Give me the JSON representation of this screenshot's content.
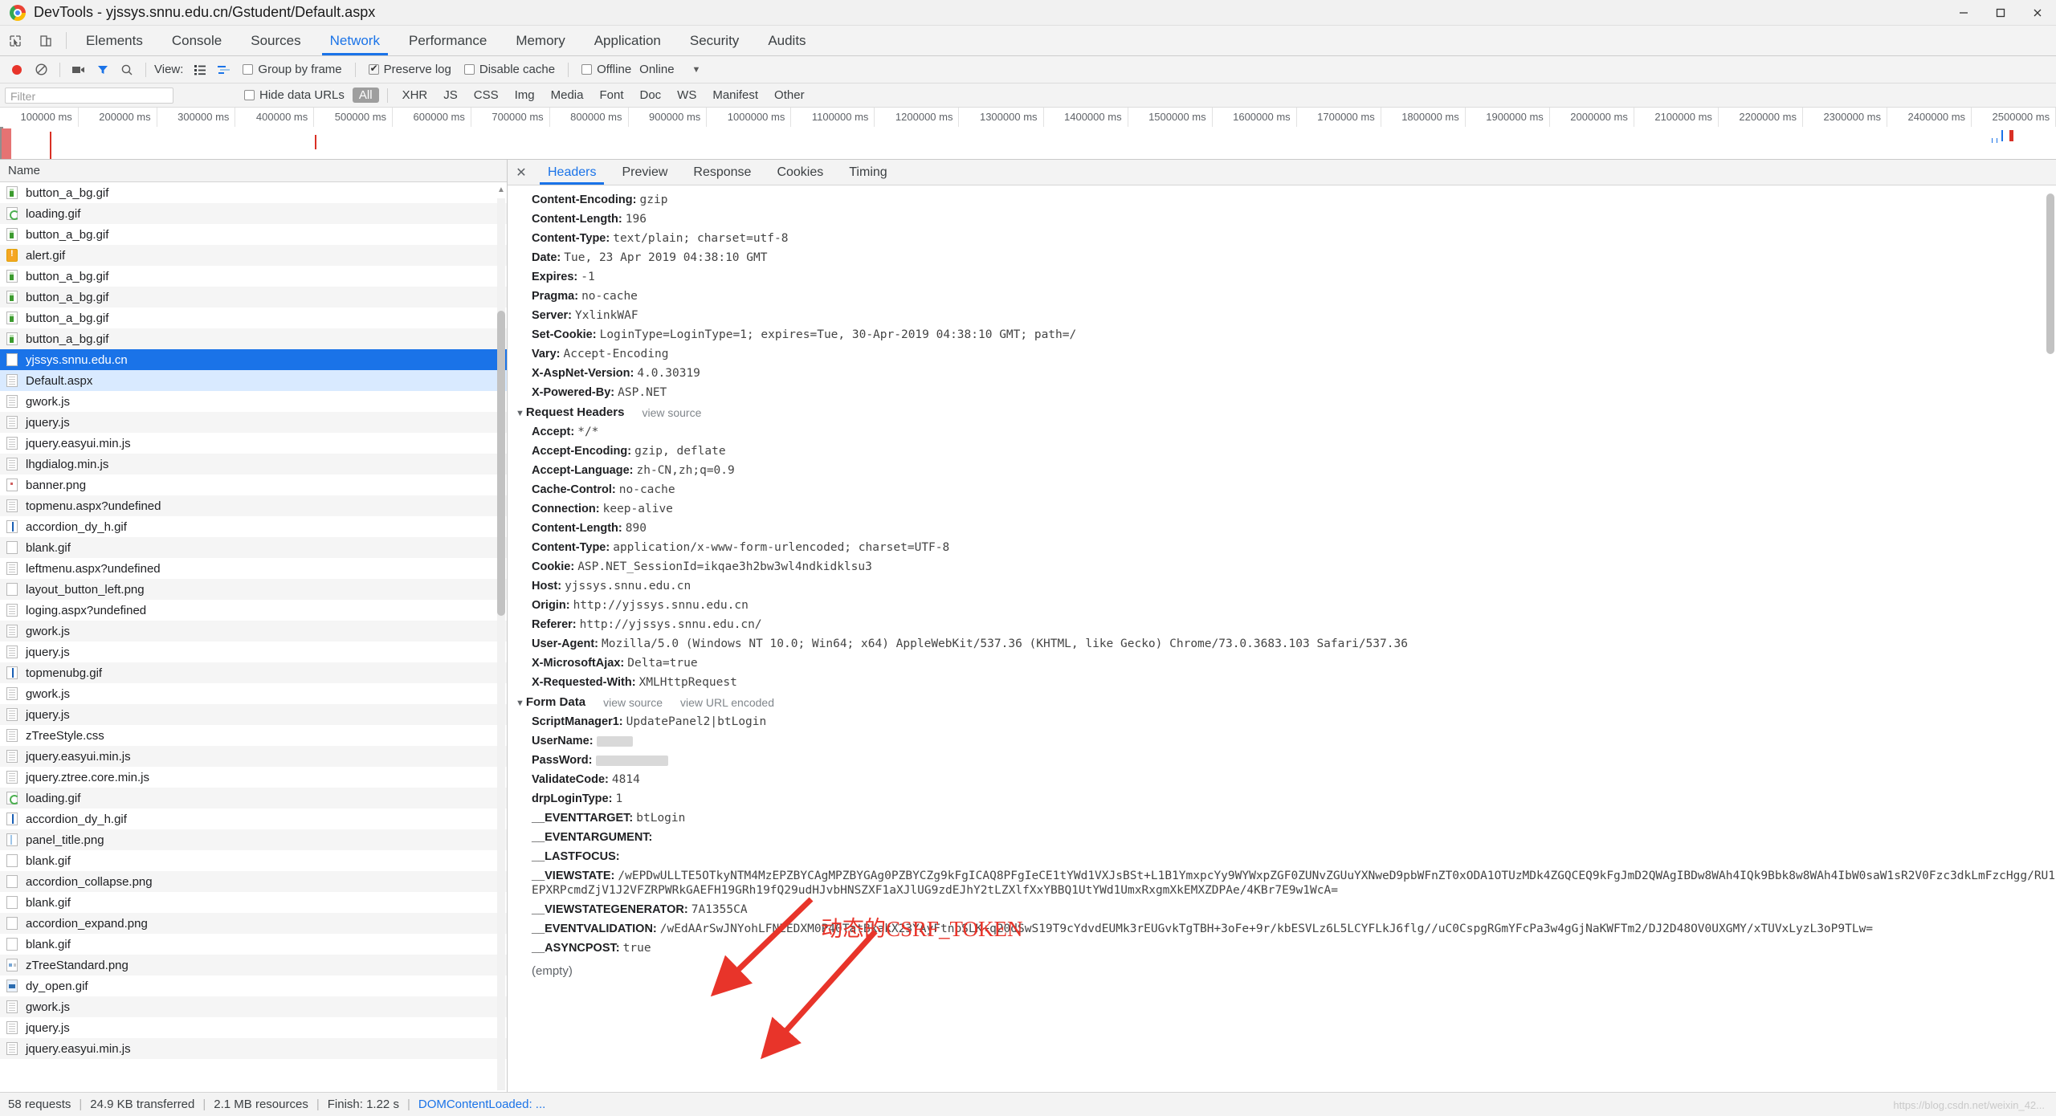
{
  "window": {
    "title": "DevTools - yjssys.snnu.edu.cn/Gstudent/Default.aspx",
    "minimize": "–",
    "maximize": "☐",
    "close": "✕"
  },
  "devtools_tabs": [
    {
      "label": "Elements",
      "active": false
    },
    {
      "label": "Console",
      "active": false
    },
    {
      "label": "Sources",
      "active": false
    },
    {
      "label": "Network",
      "active": true
    },
    {
      "label": "Performance",
      "active": false
    },
    {
      "label": "Memory",
      "active": false
    },
    {
      "label": "Application",
      "active": false
    },
    {
      "label": "Security",
      "active": false
    },
    {
      "label": "Audits",
      "active": false
    }
  ],
  "toolbar": {
    "view_label": "View:",
    "group_by_frame": "Group by frame",
    "group_by_frame_checked": false,
    "preserve_log": "Preserve log",
    "preserve_log_checked": true,
    "disable_cache": "Disable cache",
    "disable_cache_checked": false,
    "offline": "Offline",
    "offline_checked": false,
    "online": "Online",
    "throttle_caret": "▼"
  },
  "filterbar": {
    "filter_placeholder": "Filter",
    "filter_value": "",
    "hide_data_urls": "Hide data URLs",
    "hide_data_urls_checked": false,
    "types": [
      "All",
      "XHR",
      "JS",
      "CSS",
      "Img",
      "Media",
      "Font",
      "Doc",
      "WS",
      "Manifest",
      "Other"
    ],
    "active_type": "All"
  },
  "overview": {
    "ticks": [
      "100000 ms",
      "200000 ms",
      "300000 ms",
      "400000 ms",
      "500000 ms",
      "600000 ms",
      "700000 ms",
      "800000 ms",
      "900000 ms",
      "1000000 ms",
      "1100000 ms",
      "1200000 ms",
      "1300000 ms",
      "1400000 ms",
      "1500000 ms",
      "1600000 ms",
      "1700000 ms",
      "1800000 ms",
      "1900000 ms",
      "2000000 ms",
      "2100000 ms",
      "2200000 ms",
      "2300000 ms",
      "2400000 ms",
      "2500000 ms"
    ]
  },
  "list": {
    "column_header": "Name",
    "rows": [
      {
        "name": "button_a_bg.gif",
        "icon": "img-green"
      },
      {
        "name": "loading.gif",
        "icon": "loading"
      },
      {
        "name": "button_a_bg.gif",
        "icon": "img-green"
      },
      {
        "name": "alert.gif",
        "icon": "alert"
      },
      {
        "name": "button_a_bg.gif",
        "icon": "img-green"
      },
      {
        "name": "button_a_bg.gif",
        "icon": "img-green"
      },
      {
        "name": "button_a_bg.gif",
        "icon": "img-green"
      },
      {
        "name": "button_a_bg.gif",
        "icon": "img-green"
      },
      {
        "name": "yjssys.snnu.edu.cn",
        "icon": "blank",
        "state": "selected"
      },
      {
        "name": "Default.aspx",
        "icon": "doc",
        "state": "highlight"
      },
      {
        "name": "gwork.js",
        "icon": "doc"
      },
      {
        "name": "jquery.js",
        "icon": "doc"
      },
      {
        "name": "jquery.easyui.min.js",
        "icon": "doc"
      },
      {
        "name": "lhgdialog.min.js",
        "icon": "doc"
      },
      {
        "name": "banner.png",
        "icon": "dot"
      },
      {
        "name": "topmenu.aspx?undefined",
        "icon": "doc"
      },
      {
        "name": "accordion_dy_h.gif",
        "icon": "bar"
      },
      {
        "name": "blank.gif",
        "icon": "blank"
      },
      {
        "name": "leftmenu.aspx?undefined",
        "icon": "doc"
      },
      {
        "name": "layout_button_left.png",
        "icon": "blank"
      },
      {
        "name": "loging.aspx?undefined",
        "icon": "doc"
      },
      {
        "name": "gwork.js",
        "icon": "doc"
      },
      {
        "name": "jquery.js",
        "icon": "doc"
      },
      {
        "name": "topmenubg.gif",
        "icon": "bar"
      },
      {
        "name": "gwork.js",
        "icon": "doc"
      },
      {
        "name": "jquery.js",
        "icon": "doc"
      },
      {
        "name": "zTreeStyle.css",
        "icon": "doc"
      },
      {
        "name": "jquery.easyui.min.js",
        "icon": "doc"
      },
      {
        "name": "jquery.ztree.core.min.js",
        "icon": "doc"
      },
      {
        "name": "loading.gif",
        "icon": "loading"
      },
      {
        "name": "accordion_dy_h.gif",
        "icon": "bar"
      },
      {
        "name": "panel_title.png",
        "icon": "bar2"
      },
      {
        "name": "blank.gif",
        "icon": "blank"
      },
      {
        "name": "accordion_collapse.png",
        "icon": "blank"
      },
      {
        "name": "blank.gif",
        "icon": "blank"
      },
      {
        "name": "accordion_expand.png",
        "icon": "blank"
      },
      {
        "name": "blank.gif",
        "icon": "blank"
      },
      {
        "name": "zTreeStandard.png",
        "icon": "sprite"
      },
      {
        "name": "dy_open.gif",
        "icon": "dyopen"
      },
      {
        "name": "gwork.js",
        "icon": "doc"
      },
      {
        "name": "jquery.js",
        "icon": "doc"
      },
      {
        "name": "jquery.easyui.min.js",
        "icon": "doc"
      }
    ]
  },
  "detail": {
    "close_label": "✕",
    "tabs": [
      {
        "label": "Headers",
        "active": true
      },
      {
        "label": "Preview",
        "active": false
      },
      {
        "label": "Response",
        "active": false
      },
      {
        "label": "Cookies",
        "active": false
      },
      {
        "label": "Timing",
        "active": false
      }
    ],
    "response_headers": [
      {
        "k": "Content-Encoding:",
        "v": "gzip"
      },
      {
        "k": "Content-Length:",
        "v": "196"
      },
      {
        "k": "Content-Type:",
        "v": "text/plain; charset=utf-8"
      },
      {
        "k": "Date:",
        "v": "Tue, 23 Apr 2019 04:38:10 GMT"
      },
      {
        "k": "Expires:",
        "v": "-1"
      },
      {
        "k": "Pragma:",
        "v": "no-cache"
      },
      {
        "k": "Server:",
        "v": "YxlinkWAF"
      },
      {
        "k": "Set-Cookie:",
        "v": "LoginType=LoginType=1; expires=Tue, 30-Apr-2019 04:38:10 GMT; path=/"
      },
      {
        "k": "Vary:",
        "v": "Accept-Encoding"
      },
      {
        "k": "X-AspNet-Version:",
        "v": "4.0.30319"
      },
      {
        "k": "X-Powered-By:",
        "v": "ASP.NET"
      }
    ],
    "request_headers_section": {
      "caret": "▼",
      "title": "Request Headers",
      "view_source": "view source"
    },
    "request_headers": [
      {
        "k": "Accept:",
        "v": "*/*"
      },
      {
        "k": "Accept-Encoding:",
        "v": "gzip, deflate"
      },
      {
        "k": "Accept-Language:",
        "v": "zh-CN,zh;q=0.9"
      },
      {
        "k": "Cache-Control:",
        "v": "no-cache"
      },
      {
        "k": "Connection:",
        "v": "keep-alive"
      },
      {
        "k": "Content-Length:",
        "v": "890"
      },
      {
        "k": "Content-Type:",
        "v": "application/x-www-form-urlencoded; charset=UTF-8"
      },
      {
        "k": "Cookie:",
        "v": "ASP.NET_SessionId=ikqae3h2bw3wl4ndkidklsu3"
      },
      {
        "k": "Host:",
        "v": "yjssys.snnu.edu.cn"
      },
      {
        "k": "Origin:",
        "v": "http://yjssys.snnu.edu.cn"
      },
      {
        "k": "Referer:",
        "v": "http://yjssys.snnu.edu.cn/"
      },
      {
        "k": "User-Agent:",
        "v": "Mozilla/5.0 (Windows NT 10.0; Win64; x64) AppleWebKit/537.36 (KHTML, like Gecko) Chrome/73.0.3683.103 Safari/537.36"
      },
      {
        "k": "X-MicrosoftAjax:",
        "v": "Delta=true"
      },
      {
        "k": "X-Requested-With:",
        "v": "XMLHttpRequest"
      }
    ],
    "form_data_section": {
      "caret": "▼",
      "title": "Form Data",
      "view_source": "view source",
      "view_url_encoded": "view URL encoded"
    },
    "form_data": [
      {
        "k": "ScriptManager1:",
        "v": "UpdatePanel2|btLogin"
      },
      {
        "k": "UserName:",
        "v": "",
        "redacted": 45
      },
      {
        "k": "PassWord:",
        "v": "",
        "redacted": 90
      },
      {
        "k": "ValidateCode:",
        "v": "4814"
      },
      {
        "k": "drpLoginType:",
        "v": "1"
      },
      {
        "k": "__EVENTTARGET:",
        "v": "btLogin"
      },
      {
        "k": "__EVENTARGUMENT:",
        "v": ""
      },
      {
        "k": "__LASTFOCUS:",
        "v": ""
      },
      {
        "k": "__VIEWSTATE:",
        "v": "/wEPDwULLTE5OTkyNTM4MzEPZBYCAgMPZBYGAg0PZBYCZg9kFgICAQ8PFgIeCE1tYWd1VXJsBSt+L1B1YmxpcYy9WYWxpZGF0ZUNvZGUuYXNweD9pbWFnZT0xODA1OTUzMDk4ZGQCEQ9kFgJmD2QWAgIBDw8WAh4IQk9Bbk8w8WAh4IbW0saW1sR2V0Fzc3dkLmFzcHgg/RU1EPXRPcmdZjV1J2VFZRPWRkGAEFH19GRh19fQ29udHJvbHNSZXF1aXJlUG9zdEJhY2tLZXlfXxYBBQ1UtYWd1UmxRxgmXkEMXZDPAe/4KBr7E9w1WcA="
      },
      {
        "k": "__VIEWSTATEGENERATOR:",
        "v": "7A1355CA"
      },
      {
        "k": "__EVENTVALIDATION:",
        "v": "/wEdAArSwJNYohLFNEEDXM0P40TatBkakX23YAyFtnbSLK+q20dSwS19T9cYdvdEUMk3rEUGvkTgTBH+3oFe+9r/kbESVLz6L5LCYFLkJ6flg//uC0CspgRGmYFcPa3w4gGjNaKWFTm2/DJ2D48OV0UXGMY/xTUVxLyzL3oP9TLw="
      },
      {
        "k": "__ASYNCPOST:",
        "v": "true"
      }
    ],
    "empty_note": "(empty)"
  },
  "annotation": {
    "csrf_label": "动态的CSRF_TOKEN",
    "color": "#e8342a"
  },
  "statusbar": {
    "requests": "58 requests",
    "transferred": "24.9 KB transferred",
    "resources": "2.1 MB resources",
    "finish": "Finish: 1.22 s",
    "domcontentloaded": "DOMContentLoaded: ...",
    "separator": "|"
  },
  "watermark": "https://blog.csdn.net/weixin_42..."
}
